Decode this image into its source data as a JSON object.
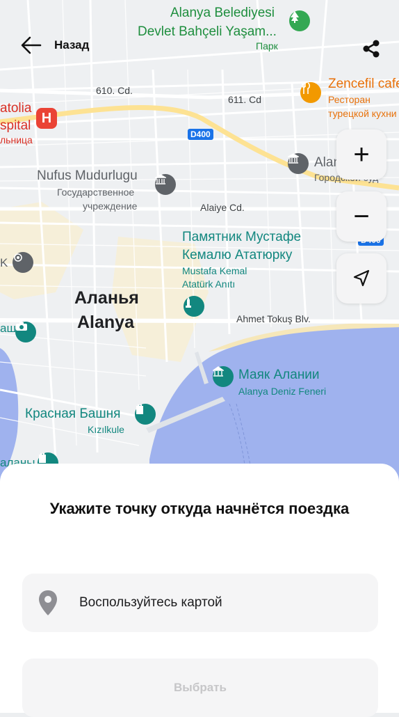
{
  "header": {
    "back_label": "Назад"
  },
  "map": {
    "labels": {
      "poi_belediye_1": "Alanya Belediyesi",
      "poi_belediye_2": "Devlet Bahçeli Yaşam...",
      "poi_belediye_type": "Парк",
      "poi_zencefil": "Zencefil cafe",
      "poi_zencefil_type_1": "Ресторан",
      "poi_zencefil_type_2": "турецкой кухни",
      "poi_hospital_1": "atolia",
      "poi_hospital_2": "spital",
      "poi_hospital_3": "льница",
      "road_610": "610. Cd.",
      "road_611": "611. Cd",
      "road_d400": "D400",
      "road_d400_b": "D400",
      "poi_court_1": "Alanya",
      "poi_court_2": "Городской суд",
      "poi_nufus_1": "Nufus Mudurlugu",
      "poi_nufus_2": "Государственное",
      "poi_nufus_3": "учреждение",
      "road_alaiye": "Alaiye Cd.",
      "poi_monument_1": "Памятник Мустафе",
      "poi_monument_2": "Кемалю Ататюрку",
      "poi_monument_3": "Mustafa Kemal",
      "poi_monument_4": "Atatürk Anıtı",
      "city_ru": "Аланья",
      "city_en": "Alanya",
      "road_ahmet": "Ahmet Tokuş Blv.",
      "poi_k": "K",
      "poi_shu": "ашч",
      "poi_lighthouse_1": "Маяк Алании",
      "poi_lighthouse_2": "Alanya Deniz Feneri",
      "poi_tower_1": "Красная Башня",
      "poi_tower_2": "Kızılkule",
      "poi_bottom_left": "аланы"
    }
  },
  "controls": {
    "zoom_in": "+",
    "zoom_out": "−"
  },
  "sheet": {
    "title": "Укажите точку откуда начнётся поездка",
    "location_field": "Воспользуйтесь картой",
    "select_button": "Выбрать"
  },
  "colors": {
    "map_bg": "#eef0f2",
    "water": "#9fb2ee",
    "road_yellow": "#fde293",
    "teal": "#12877f",
    "green": "#1e8e3e",
    "orange": "#e8710a",
    "red": "#d93025"
  }
}
